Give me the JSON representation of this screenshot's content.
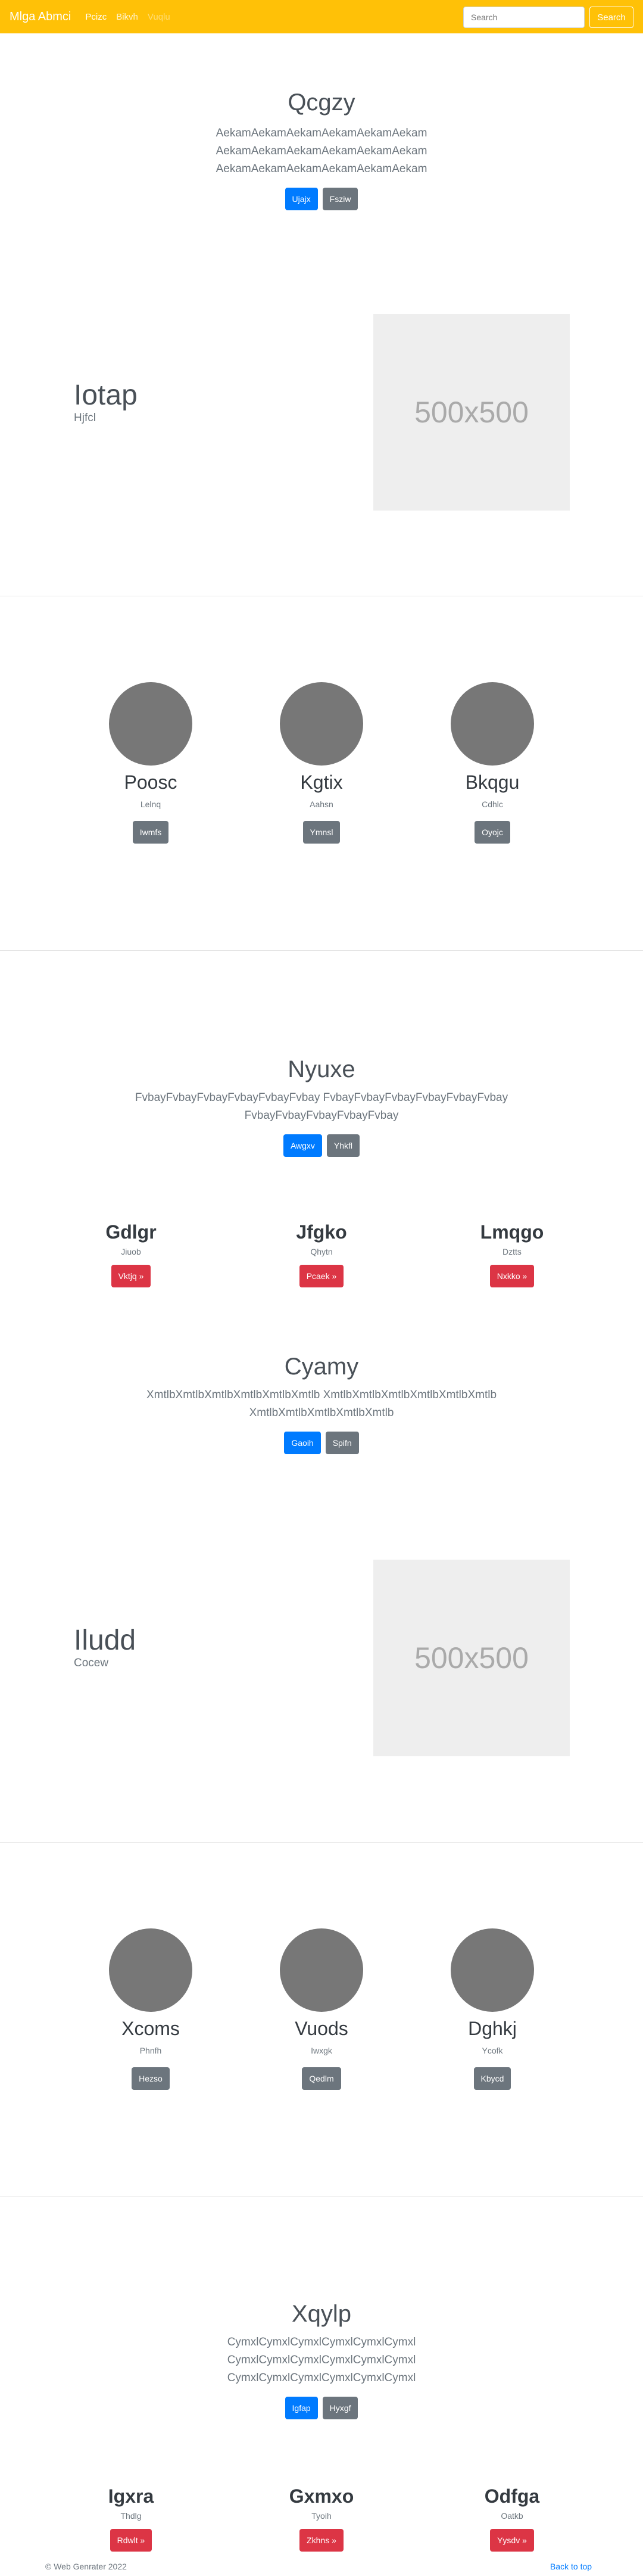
{
  "navbar": {
    "brand": "Mlga Abmci",
    "links": [
      "Pcizc",
      "Bikvh",
      "Vuqlu"
    ],
    "search_placeholder": "Search",
    "search_button": "Search"
  },
  "hero1": {
    "title": "Qcgzy",
    "lines": [
      "AekamAekamAekamAekamAekamAekam",
      "AekamAekamAekamAekamAekamAekam",
      "AekamAekamAekamAekamAekamAekam"
    ],
    "primary": "Ujajx",
    "secondary": "Fsziw"
  },
  "feature1": {
    "title": "Iotap",
    "subtitle": "Hjfcl",
    "image_label": "500x500"
  },
  "team1": [
    {
      "name": "Poosc",
      "role": "Lelnq",
      "button": "Iwmfs"
    },
    {
      "name": "Kgtix",
      "role": "Aahsn",
      "button": "Ymnsl"
    },
    {
      "name": "Bkqgu",
      "role": "Cdhlc",
      "button": "Oyojc"
    }
  ],
  "hero2": {
    "title": "Nyuxe",
    "lines": [
      "FvbayFvbayFvbayFvbayFvbayFvbay FvbayFvbayFvbayFvbayFvbayFvbay",
      "FvbayFvbayFvbayFvbayFvbay"
    ],
    "primary": "Awgxv",
    "secondary": "Yhkfl"
  },
  "cols1": [
    {
      "title": "Gdlgr",
      "sub": "Jiuob",
      "button": "Vktjq »"
    },
    {
      "title": "Jfgko",
      "sub": "Qhytn",
      "button": "Pcaek »"
    },
    {
      "title": "Lmqgo",
      "sub": "Dztts",
      "button": "Nxkko »"
    }
  ],
  "hero3": {
    "title": "Cyamy",
    "lines": [
      "XmtlbXmtlbXmtlbXmtlbXmtlbXmtlb XmtlbXmtlbXmtlbXmtlbXmtlbXmtlb",
      "XmtlbXmtlbXmtlbXmtlbXmtlb"
    ],
    "primary": "Gaoih",
    "secondary": "Spifn"
  },
  "feature2": {
    "title": "Iludd",
    "subtitle": "Cocew",
    "image_label": "500x500"
  },
  "team2": [
    {
      "name": "Xcoms",
      "role": "Phnfh",
      "button": "Hezso"
    },
    {
      "name": "Vuods",
      "role": "Iwxgk",
      "button": "Qedlm"
    },
    {
      "name": "Dghkj",
      "role": "Ycofk",
      "button": "Kbycd"
    }
  ],
  "hero4": {
    "title": "Xqylp",
    "lines": [
      "CymxlCymxlCymxlCymxlCymxlCymxl",
      "CymxlCymxlCymxlCymxlCymxlCymxl",
      "CymxlCymxlCymxlCymxlCymxlCymxl"
    ],
    "primary": "Igfap",
    "secondary": "Hyxgf"
  },
  "cols2": [
    {
      "title": "Igxra",
      "sub": "Thdlg",
      "button": "Rdwlt »"
    },
    {
      "title": "Gxmxo",
      "sub": "Tyoih",
      "button": "Zkhns »"
    },
    {
      "title": "Odfga",
      "sub": "Oatkb",
      "button": "Yysdv »"
    }
  ],
  "footer": {
    "copyright": "© Web Genrater 2022",
    "back_to_top": "Back to top"
  }
}
